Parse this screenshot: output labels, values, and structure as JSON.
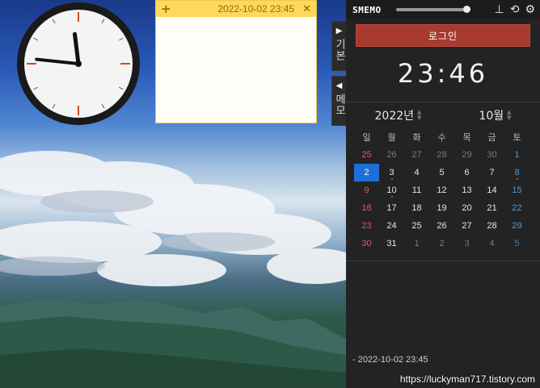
{
  "note": {
    "add_label": "+",
    "timestamp": "2022-10-02  23:45",
    "close_label": "✕"
  },
  "side_tabs": {
    "basic": {
      "arrow": "▶",
      "label": "기본"
    },
    "memo": {
      "arrow": "◀",
      "label": "메모"
    }
  },
  "panel": {
    "logo": "SMEMO",
    "opacity_slider": 0.95,
    "icons": [
      "pin-icon",
      "refresh-icon",
      "gear-icon"
    ],
    "pin_glyph": "⊥",
    "refresh_glyph": "⟲",
    "gear_glyph": "⚙",
    "login_label": "로그인",
    "digital_time": "23:46"
  },
  "calendar": {
    "year_label": "2022년",
    "month_label": "10월",
    "weekdays": [
      "일",
      "월",
      "화",
      "수",
      "목",
      "금",
      "토"
    ],
    "weeks": [
      [
        "25",
        "26",
        "27",
        "28",
        "29",
        "30",
        "1"
      ],
      [
        "2",
        "3",
        "4",
        "5",
        "6",
        "7",
        "8"
      ],
      [
        "9",
        "10",
        "11",
        "12",
        "13",
        "14",
        "15"
      ],
      [
        "16",
        "17",
        "18",
        "19",
        "20",
        "21",
        "22"
      ],
      [
        "23",
        "24",
        "25",
        "26",
        "27",
        "28",
        "29"
      ],
      [
        "30",
        "31",
        "1",
        "2",
        "3",
        "4",
        "5"
      ]
    ],
    "today": "2"
  },
  "memo_entry": "- 2022-10-02  23:45",
  "blog_url": "https://luckyman717.tistory.com",
  "analog_clock": {
    "hour": 11,
    "minute": 46
  },
  "colors": {
    "panel_bg": "#232323",
    "login_red": "#a93a30",
    "today_blue": "#1f6fd8",
    "note_yellow": "#ffd85a"
  }
}
